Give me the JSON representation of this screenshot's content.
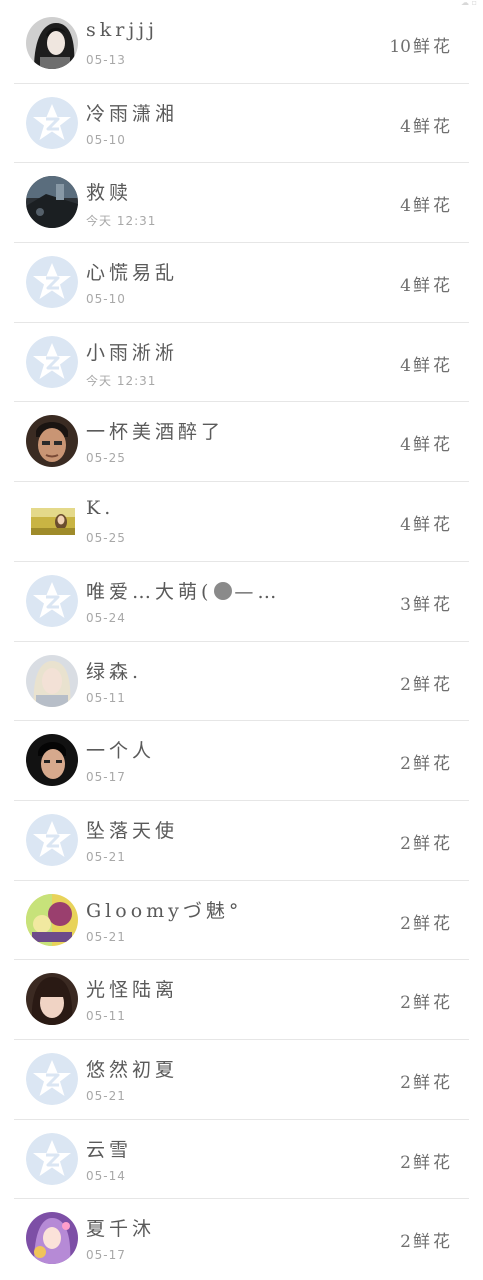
{
  "status": {
    "mark": "☁ ▫"
  },
  "flower_unit": "鲜花",
  "rows": [
    {
      "name": "skrjjj",
      "date": "05-13",
      "count": "10",
      "avatar": "photo-dark-hair-icon"
    },
    {
      "name": "冷雨潇湘",
      "date": "05-10",
      "count": "4",
      "avatar": "default-qq-star-icon"
    },
    {
      "name": "救赎",
      "date": "今天 12:31",
      "count": "4",
      "avatar": "photo-street-scene-icon"
    },
    {
      "name": "心慌易乱",
      "date": "05-10",
      "count": "4",
      "avatar": "default-qq-star-icon"
    },
    {
      "name": "小雨淅淅",
      "date": "今天 12:31",
      "count": "4",
      "avatar": "default-qq-star-icon"
    },
    {
      "name": "一杯美酒醉了",
      "date": "05-25",
      "count": "4",
      "avatar": "photo-man-face-icon"
    },
    {
      "name": "K.",
      "date": "05-25",
      "count": "4",
      "avatar": "photo-yellow-field-icon"
    },
    {
      "name": "唯爱…大萌(",
      "name_suffix": "—…",
      "date": "05-24",
      "count": "3",
      "avatar": "default-qq-star-icon"
    },
    {
      "name": "绿森.",
      "date": "05-11",
      "count": "2",
      "avatar": "photo-blonde-girl-icon"
    },
    {
      "name": "一个人",
      "date": "05-17",
      "count": "2",
      "avatar": "photo-young-man-icon"
    },
    {
      "name": "坠落天使",
      "date": "05-21",
      "count": "2",
      "avatar": "default-qq-star-icon"
    },
    {
      "name": "Gloomyづ魅°",
      "date": "05-21",
      "count": "2",
      "avatar": "photo-colorful-art-icon"
    },
    {
      "name": "光怪陆离",
      "date": "05-11",
      "count": "2",
      "avatar": "photo-girl-bangs-icon"
    },
    {
      "name": "悠然初夏",
      "date": "05-21",
      "count": "2",
      "avatar": "default-qq-star-icon"
    },
    {
      "name": "云雪",
      "date": "05-14",
      "count": "2",
      "avatar": "default-qq-star-icon"
    },
    {
      "name": "夏千沐",
      "date": "05-17",
      "count": "2",
      "avatar": "photo-anime-purple-icon"
    }
  ]
}
